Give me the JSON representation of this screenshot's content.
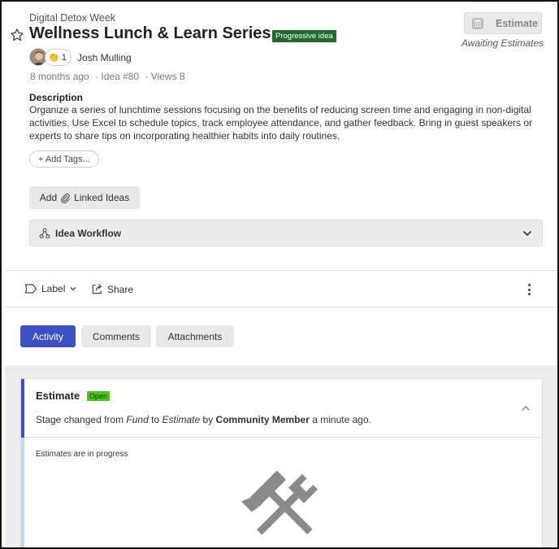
{
  "idea": {
    "campaign": "Digital Detox Week",
    "title": "Wellness Lunch & Learn Series",
    "status_badge": "Progressive idea",
    "author": "Josh Mulling",
    "clap_count": "1",
    "clap_emoji": "👏",
    "meta": {
      "age": "8 months ago",
      "idea_number": "· Idea #80",
      "views": "· Views 8"
    },
    "description_heading": "Description",
    "description": "Organize a series of lunchtime sessions focusing on the benefits of reducing screen time and engaging in non-digital activities. Use Excel to schedule topics, track employee attendance, and gather feedback. Bring in guest speakers or experts to share tips on incorporating healthier habits into daily routines."
  },
  "estimate_button": {
    "label": "Estimate",
    "status": "Awaiting Estimates"
  },
  "add_tags_label": "+ Add Tags...",
  "linked_ideas": {
    "prefix": "Add",
    "label": "Linked Ideas"
  },
  "workflow_label": "Idea Workflow",
  "actions": {
    "label": "Label",
    "share": "Share"
  },
  "tabs": [
    {
      "label": "Activity",
      "active": true
    },
    {
      "label": "Comments",
      "active": false
    },
    {
      "label": "Attachments",
      "active": false
    }
  ],
  "activity_card": {
    "title": "Estimate",
    "badge": "Open",
    "stage_text": {
      "prefix": "Stage changed from",
      "from": "Fund",
      "to_word": "to",
      "to": "Estimate",
      "by_word": "by",
      "by": "Community Member",
      "when": "a minute ago."
    },
    "note": "Estimates are in progress"
  },
  "colors": {
    "accent": "#3c4fc4",
    "progressive_badge": "#1f6b2e",
    "open_badge": "#4cc61e"
  },
  "icons": [
    "star-icon",
    "calculator-icon",
    "link-icon",
    "workflow-icon",
    "chevron-down-icon",
    "tag-icon",
    "share-icon",
    "kebab-menu-icon",
    "chevron-up-icon",
    "hammer-wrench-icon"
  ]
}
